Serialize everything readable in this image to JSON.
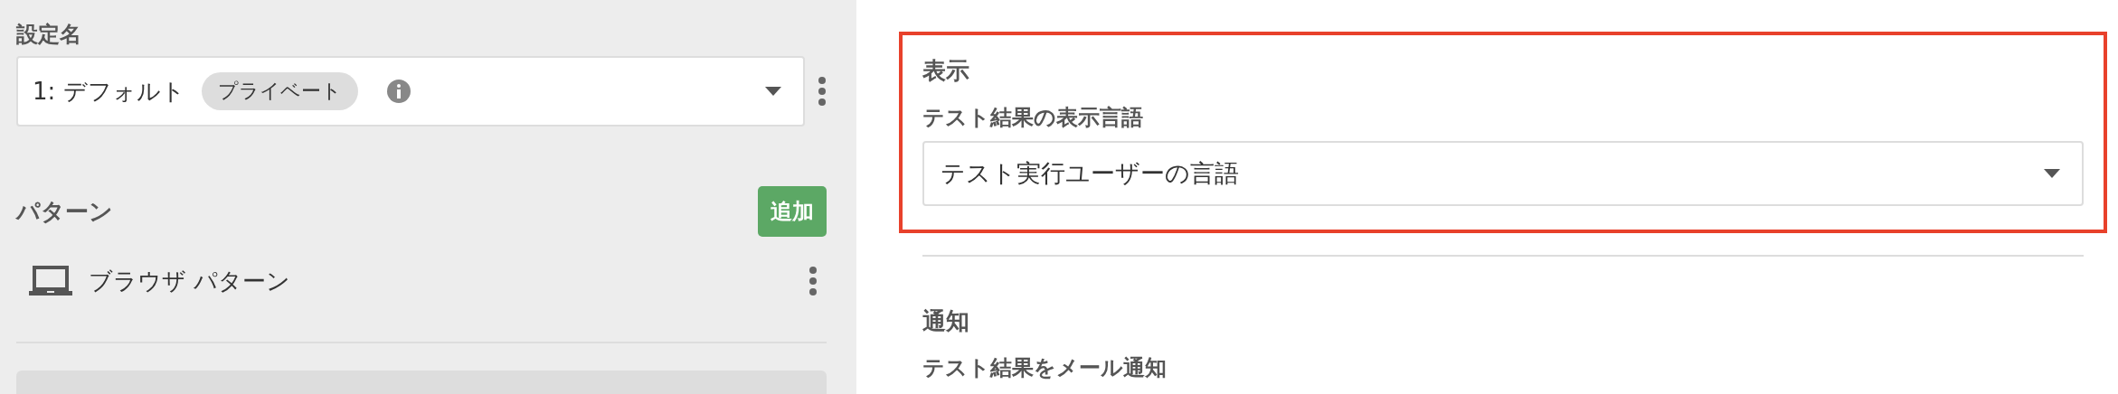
{
  "settings": {
    "label": "設定名",
    "selected_value": "1: デフォルト",
    "badge": "プライベート"
  },
  "patterns": {
    "title": "パターン",
    "add_button": "追加",
    "items": [
      {
        "kind": "browser",
        "label": "ブラウザ パターン"
      }
    ]
  },
  "sections": [
    {
      "title": "表示",
      "highlighted": true,
      "field_label": "テスト結果の表示言語",
      "value": "テスト実行ユーザーの言語"
    },
    {
      "title": "通知",
      "highlighted": false,
      "field_label": "テスト結果をメール通知"
    }
  ]
}
